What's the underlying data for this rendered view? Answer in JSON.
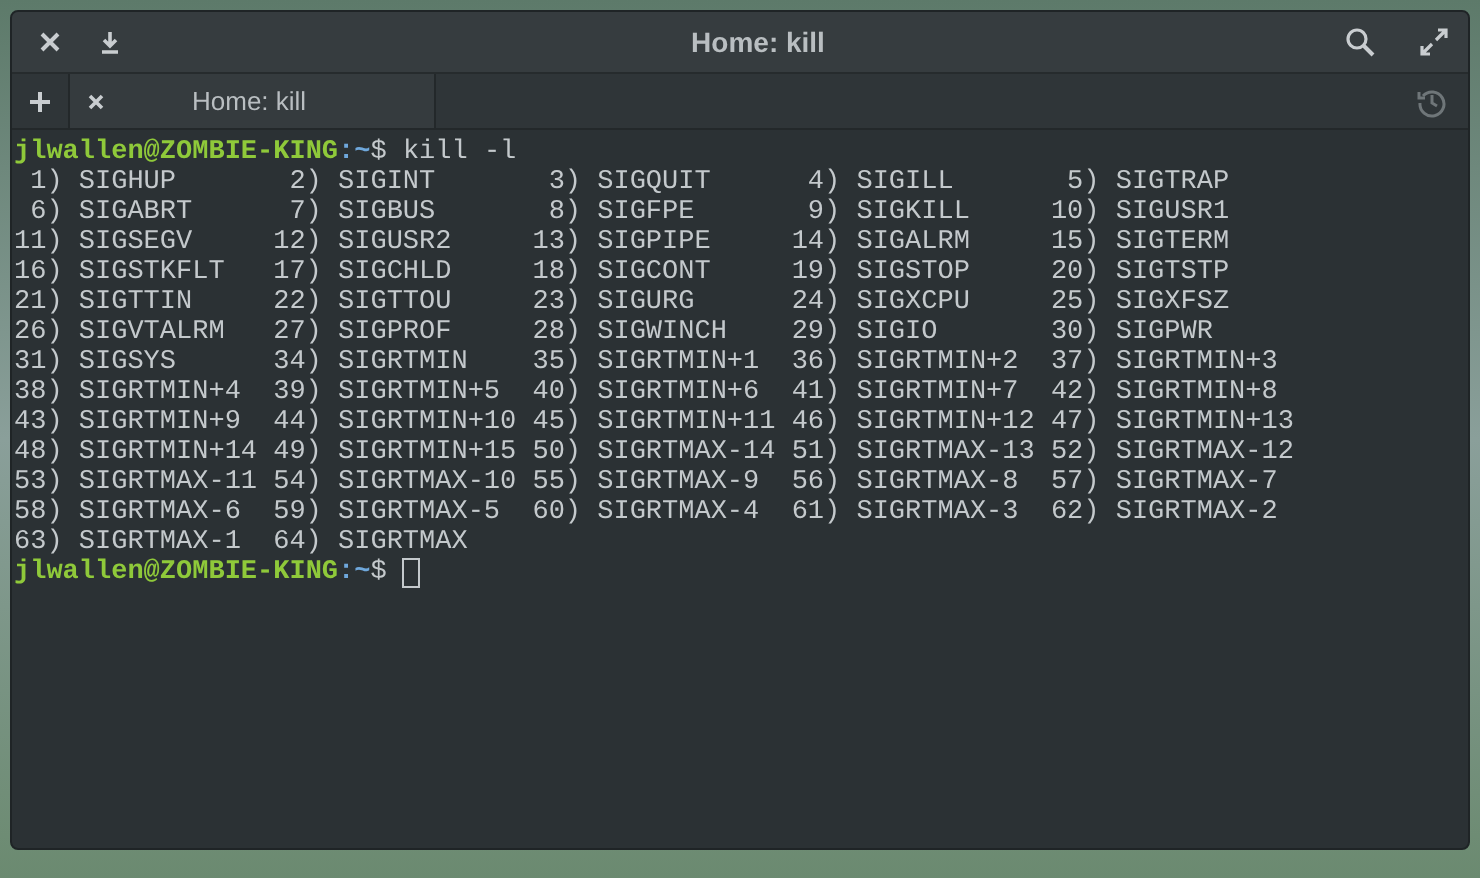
{
  "window": {
    "title": "Home: kill"
  },
  "tabs": [
    {
      "label": "Home: kill",
      "selected": true
    }
  ],
  "terminal": {
    "lines": [
      {
        "kind": "prompt",
        "user_host": "jlwallen@ZOMBIE-KING",
        "path": ":~",
        "symbol": "$",
        "command": "kill -l",
        "cursor": false
      },
      {
        "kind": "output",
        "cells": [
          " 1) SIGHUP",
          " 2) SIGINT",
          " 3) SIGQUIT",
          " 4) SIGILL",
          " 5) SIGTRAP"
        ]
      },
      {
        "kind": "output",
        "cells": [
          " 6) SIGABRT",
          " 7) SIGBUS",
          " 8) SIGFPE",
          " 9) SIGKILL",
          "10) SIGUSR1"
        ]
      },
      {
        "kind": "output",
        "cells": [
          "11) SIGSEGV",
          "12) SIGUSR2",
          "13) SIGPIPE",
          "14) SIGALRM",
          "15) SIGTERM"
        ]
      },
      {
        "kind": "output",
        "cells": [
          "16) SIGSTKFLT",
          "17) SIGCHLD",
          "18) SIGCONT",
          "19) SIGSTOP",
          "20) SIGTSTP"
        ]
      },
      {
        "kind": "output",
        "cells": [
          "21) SIGTTIN",
          "22) SIGTTOU",
          "23) SIGURG",
          "24) SIGXCPU",
          "25) SIGXFSZ"
        ]
      },
      {
        "kind": "output",
        "cells": [
          "26) SIGVTALRM",
          "27) SIGPROF",
          "28) SIGWINCH",
          "29) SIGIO",
          "30) SIGPWR"
        ]
      },
      {
        "kind": "output",
        "cells": [
          "31) SIGSYS",
          "34) SIGRTMIN",
          "35) SIGRTMIN+1",
          "36) SIGRTMIN+2",
          "37) SIGRTMIN+3"
        ]
      },
      {
        "kind": "output",
        "cells": [
          "38) SIGRTMIN+4",
          "39) SIGRTMIN+5",
          "40) SIGRTMIN+6",
          "41) SIGRTMIN+7",
          "42) SIGRTMIN+8"
        ]
      },
      {
        "kind": "output",
        "cells": [
          "43) SIGRTMIN+9",
          "44) SIGRTMIN+10",
          "45) SIGRTMIN+11",
          "46) SIGRTMIN+12",
          "47) SIGRTMIN+13"
        ]
      },
      {
        "kind": "output",
        "cells": [
          "48) SIGRTMIN+14",
          "49) SIGRTMIN+15",
          "50) SIGRTMAX-14",
          "51) SIGRTMAX-13",
          "52) SIGRTMAX-12"
        ]
      },
      {
        "kind": "output",
        "cells": [
          "53) SIGRTMAX-11",
          "54) SIGRTMAX-10",
          "55) SIGRTMAX-9",
          "56) SIGRTMAX-8",
          "57) SIGRTMAX-7"
        ]
      },
      {
        "kind": "output",
        "cells": [
          "58) SIGRTMAX-6",
          "59) SIGRTMAX-5",
          "60) SIGRTMAX-4",
          "61) SIGRTMAX-3",
          "62) SIGRTMAX-2"
        ]
      },
      {
        "kind": "output",
        "cells": [
          "63) SIGRTMAX-1",
          "64) SIGRTMAX"
        ]
      },
      {
        "kind": "prompt",
        "user_host": "jlwallen@ZOMBIE-KING",
        "path": ":~",
        "symbol": "$",
        "cursor": true
      }
    ]
  }
}
